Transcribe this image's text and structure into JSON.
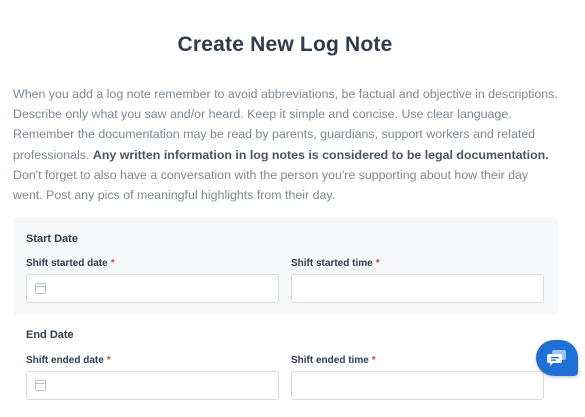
{
  "page": {
    "title": "Create New Log Note"
  },
  "intro": {
    "text_before": "When you add a log note remember to avoid abbreviations, be factual and objective in descriptions. Describe only what you saw and/or heard. Keep it simple and concise. Use clear language. Remember the documentation may be read by parents, guardians, support workers and related professionals. ",
    "bold": "Any written information in log notes is considered to be legal documentation.",
    "text_after": " Don't forget to also have a conversation with the person you're supporting about how their day went. Post any pics of meaningful highlights from their day."
  },
  "start_section": {
    "title": "Start Date",
    "date_label": "Shift started date",
    "time_label": "Shift started time",
    "required_mark": "*"
  },
  "end_section": {
    "title": "End Date",
    "date_label": "Shift ended date",
    "time_label": "Shift ended time",
    "required_mark": "*"
  },
  "colors": {
    "accent": "#1f6fd6",
    "required": "#e0483e",
    "heading": "#2e3c4c"
  },
  "icons": {
    "date_field": "calendar-icon",
    "chat": "chat-icon"
  }
}
